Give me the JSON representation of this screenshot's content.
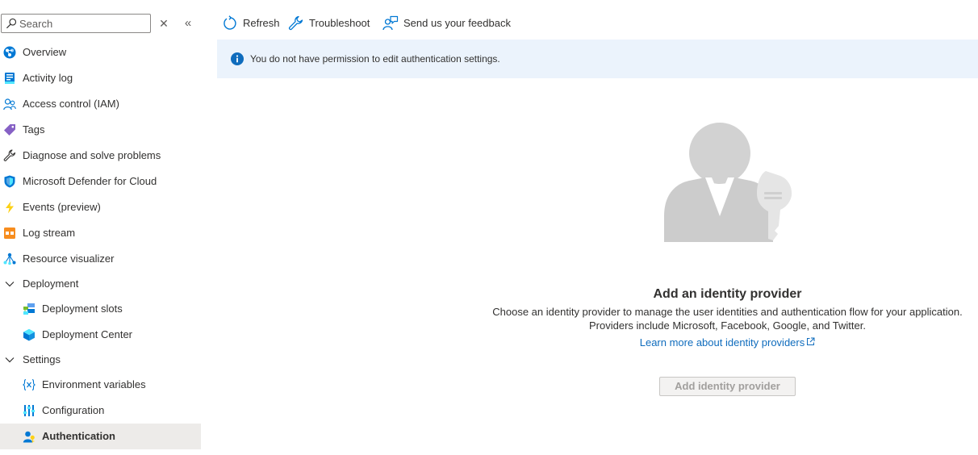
{
  "sidebar": {
    "search": {
      "placeholder": "Search",
      "value": ""
    },
    "clear_glyph": "✕",
    "collapse_glyph": "«",
    "items": [
      {
        "label": "Overview",
        "icon": "overview-icon"
      },
      {
        "label": "Activity log",
        "icon": "activity-log-icon"
      },
      {
        "label": "Access control (IAM)",
        "icon": "access-control-icon"
      },
      {
        "label": "Tags",
        "icon": "tag-icon"
      },
      {
        "label": "Diagnose and solve problems",
        "icon": "wrench-icon"
      },
      {
        "label": "Microsoft Defender for Cloud",
        "icon": "shield-icon"
      },
      {
        "label": "Events (preview)",
        "icon": "lightning-icon"
      },
      {
        "label": "Log stream",
        "icon": "log-stream-icon"
      },
      {
        "label": "Resource visualizer",
        "icon": "resource-visualizer-icon"
      },
      {
        "label": "Deployment",
        "icon": "chevron-down-icon",
        "group": true,
        "expanded": true
      },
      {
        "label": "Deployment slots",
        "icon": "deployment-slots-icon",
        "sub": true
      },
      {
        "label": "Deployment Center",
        "icon": "deployment-center-icon",
        "sub": true
      },
      {
        "label": "Settings",
        "icon": "chevron-down-icon",
        "group": true,
        "expanded": true
      },
      {
        "label": "Environment variables",
        "icon": "variable-icon",
        "sub": true
      },
      {
        "label": "Configuration",
        "icon": "configuration-icon",
        "sub": true
      },
      {
        "label": "Authentication",
        "icon": "authentication-icon",
        "sub": true,
        "active": true
      }
    ]
  },
  "toolbar": {
    "refresh": "Refresh",
    "troubleshoot": "Troubleshoot",
    "feedback": "Send us your feedback"
  },
  "banner": {
    "text": "You do not have permission to edit authentication settings."
  },
  "empty_state": {
    "title": "Add an identity provider",
    "description_line1": "Choose an identity provider to manage the user identities and authentication flow for your application.",
    "description_line2": "Providers include Microsoft, Facebook, Google, and Twitter.",
    "learn_more": "Learn more about identity providers",
    "add_button": "Add identity provider"
  },
  "colors": {
    "accent": "#0f6cbd",
    "banner_bg": "#ebf3fc",
    "active_bg": "#edebe9",
    "disabled_text": "#a19f9d"
  }
}
